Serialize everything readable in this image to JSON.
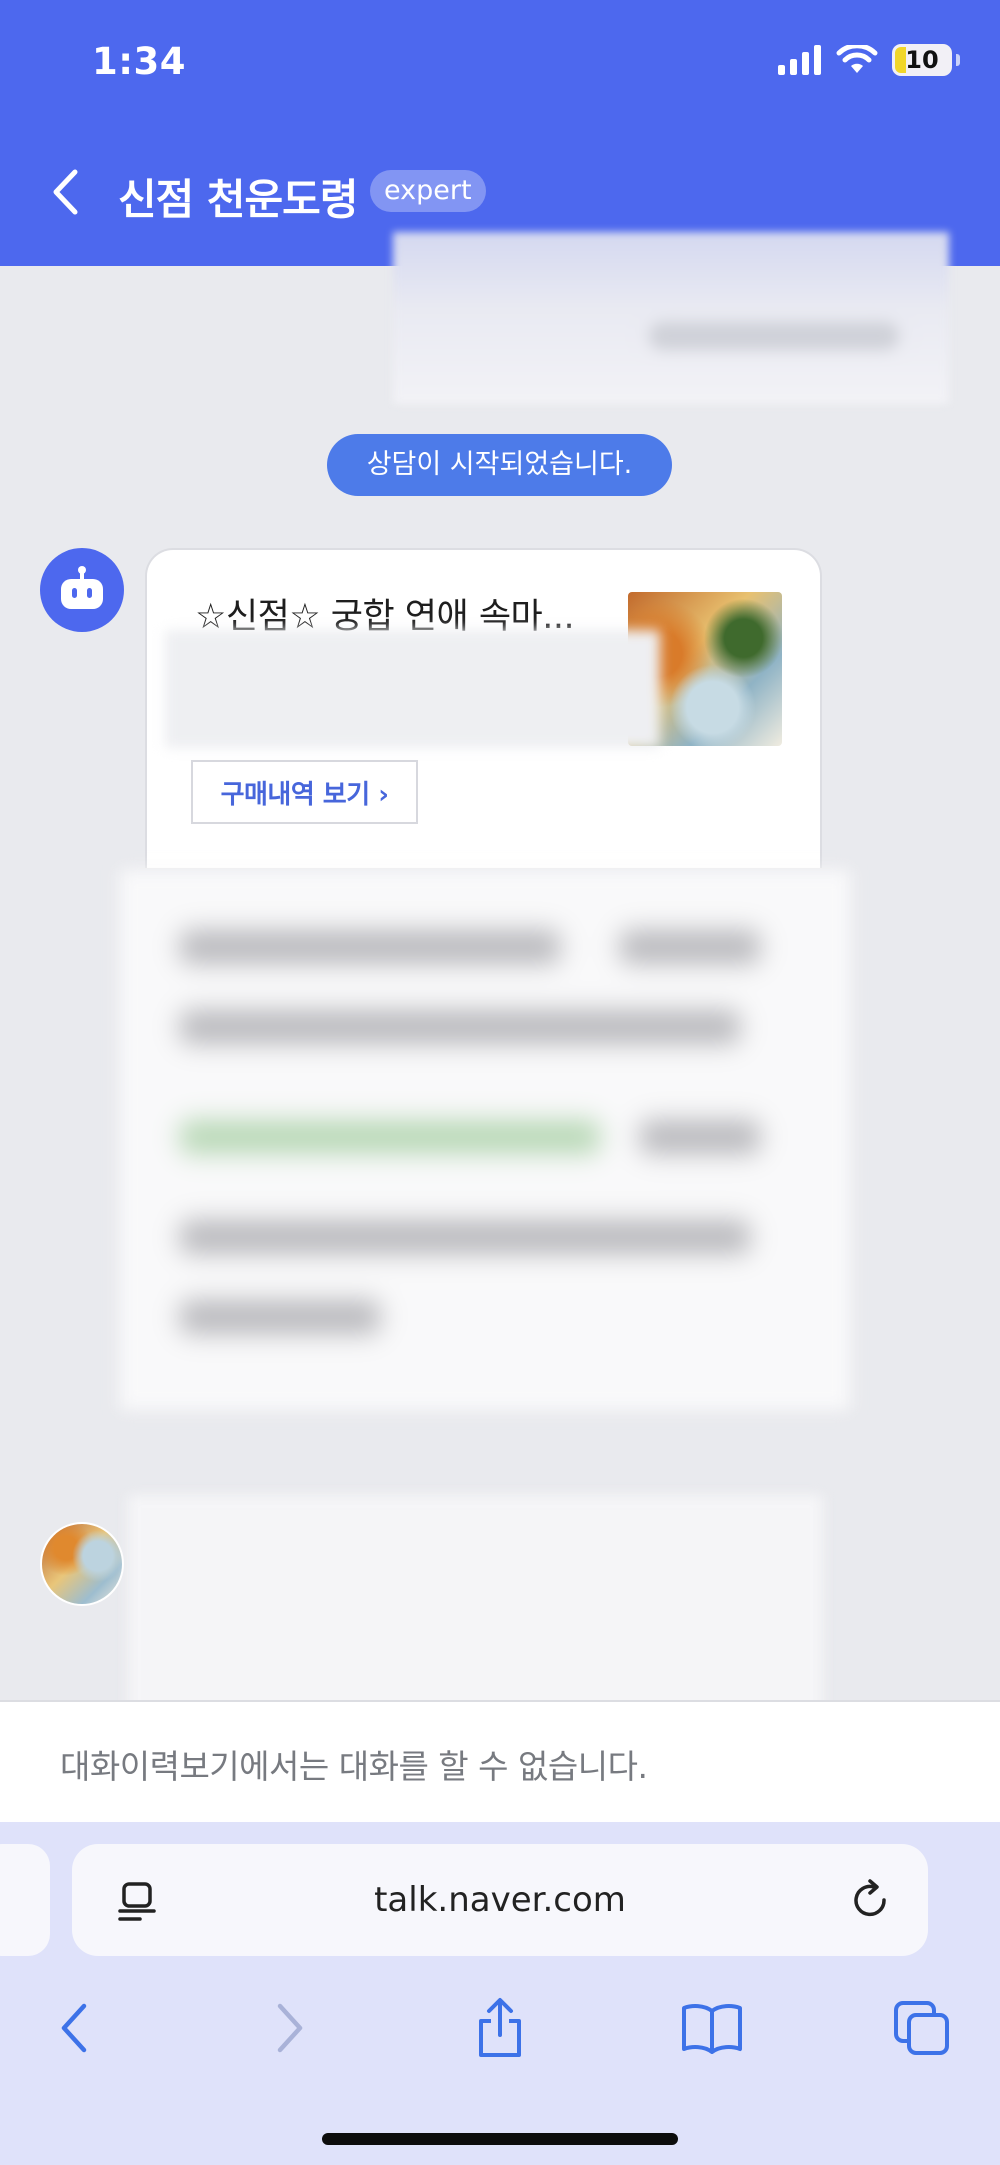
{
  "status_bar": {
    "time": "1:34",
    "battery": "10"
  },
  "header": {
    "title": "신점 천운도령",
    "badge": "expert"
  },
  "system_message": "상담이 시작되었습니다.",
  "product_card": {
    "title": "☆신점☆ 궁합 연애 속마...",
    "history_button": "구매내역 보기 ›"
  },
  "notice": "대화이력보기에서는 대화를 할 수 없습니다.",
  "browser": {
    "url": "talk.naver.com"
  },
  "colors": {
    "header_bg": "#4d68ee",
    "pill_bg": "#4d7be9",
    "link": "#4766db",
    "browser_bg": "#dfe2fa"
  }
}
